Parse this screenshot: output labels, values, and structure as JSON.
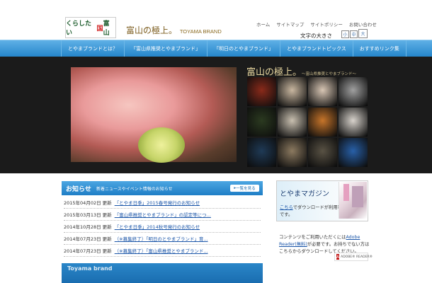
{
  "header": {
    "logo_left_prefix": "くらしたい",
    "logo_left_mark": "国",
    "logo_left_suffix": "富山",
    "logo_main": "富山の極上。",
    "logo_en": "TOYAMA BRAND",
    "top_links": [
      "ホーム",
      "サイトマップ",
      "サイトポリシー",
      "お問い合わせ"
    ],
    "font_size_label": "文字の大きさ",
    "font_sizes": [
      "小",
      "中",
      "大"
    ]
  },
  "nav": {
    "items": [
      "とやまブランドとは？",
      "「富山県推奨とやまブランド」",
      "「明日のとやまブランド」",
      "とやまブランドトピックス",
      "おすすめリンク集"
    ]
  },
  "hero": {
    "title": "富山の極上。",
    "subtitle": "〜富山県推奨とやまブランド〜",
    "thumb_colors": [
      "#8a2a1a",
      "#c9b7a0",
      "#d8c6b4",
      "#a0a0a0",
      "#2b3a20",
      "#c9c0b0",
      "#c7752a",
      "#d8d3cc",
      "#1f3a56",
      "#8c7a60",
      "#595244",
      "#2860a8"
    ]
  },
  "news": {
    "title": "お知らせ",
    "subtitle": "新着ニュースやイベント情報のお知らせ",
    "more_label": "一覧を見る",
    "items": [
      {
        "date": "2015年04月02日 更新",
        "link": "「とやま日季」2015春号発行のお知らせ"
      },
      {
        "date": "2015年03月13日 更新",
        "link": "「富山県推奨とやまブランド」の認定等につ..."
      },
      {
        "date": "2014年10月28日 更新",
        "link": "「とやま日季」2014秋号発行のお知らせ"
      },
      {
        "date": "2014年07月23日 更新",
        "link": "（※募集終了）「明日のとやまブランド」育..."
      },
      {
        "date": "2014年07月23日 更新",
        "link": "（※募集終了）「富山県推奨とやまブランド..."
      }
    ],
    "bottom_bar_text": "Toyama brand"
  },
  "magazine": {
    "title": "とやまマガジン",
    "desc_link": "こちら",
    "desc_rest": "でダウンロードが利用可能です。"
  },
  "reader": {
    "text_before": "コンテンツをご利用いただくには",
    "link": "Adobe Reader(無料)",
    "text_after": "が必要です。お持ちでない方はこちらからダウンロードしてください。",
    "badge_label": "ADOBE® READER®"
  }
}
